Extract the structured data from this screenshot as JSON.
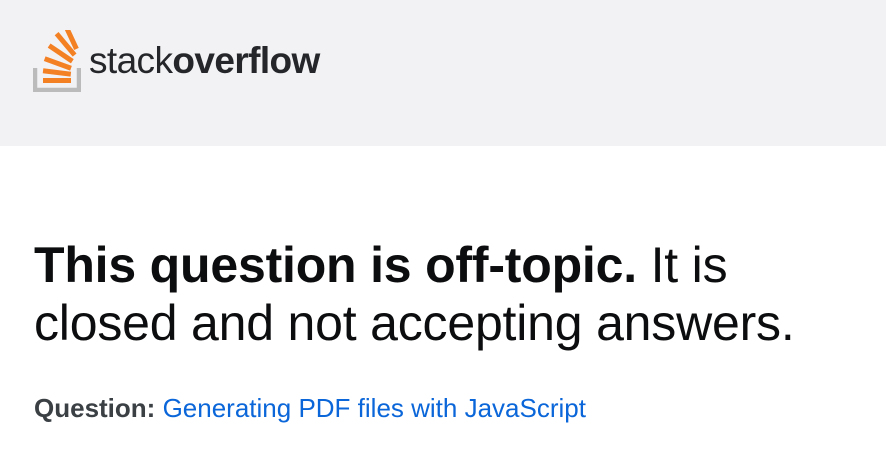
{
  "header": {
    "logo": {
      "icon": "stack-overflow-logo-icon",
      "word_light": "stack",
      "word_bold": "overflow",
      "colors": {
        "stack_orange": "#f48024",
        "tray_gray": "#bcbbbb",
        "text": "#242629"
      }
    },
    "background": "#f2f2f4"
  },
  "notice": {
    "strong_text": "This question is off-topic.",
    "normal_text": "It is closed and not accepting answers."
  },
  "question": {
    "label": "Question:",
    "title": "Generating PDF files with JavaScript",
    "link_color": "#0a66d9"
  }
}
